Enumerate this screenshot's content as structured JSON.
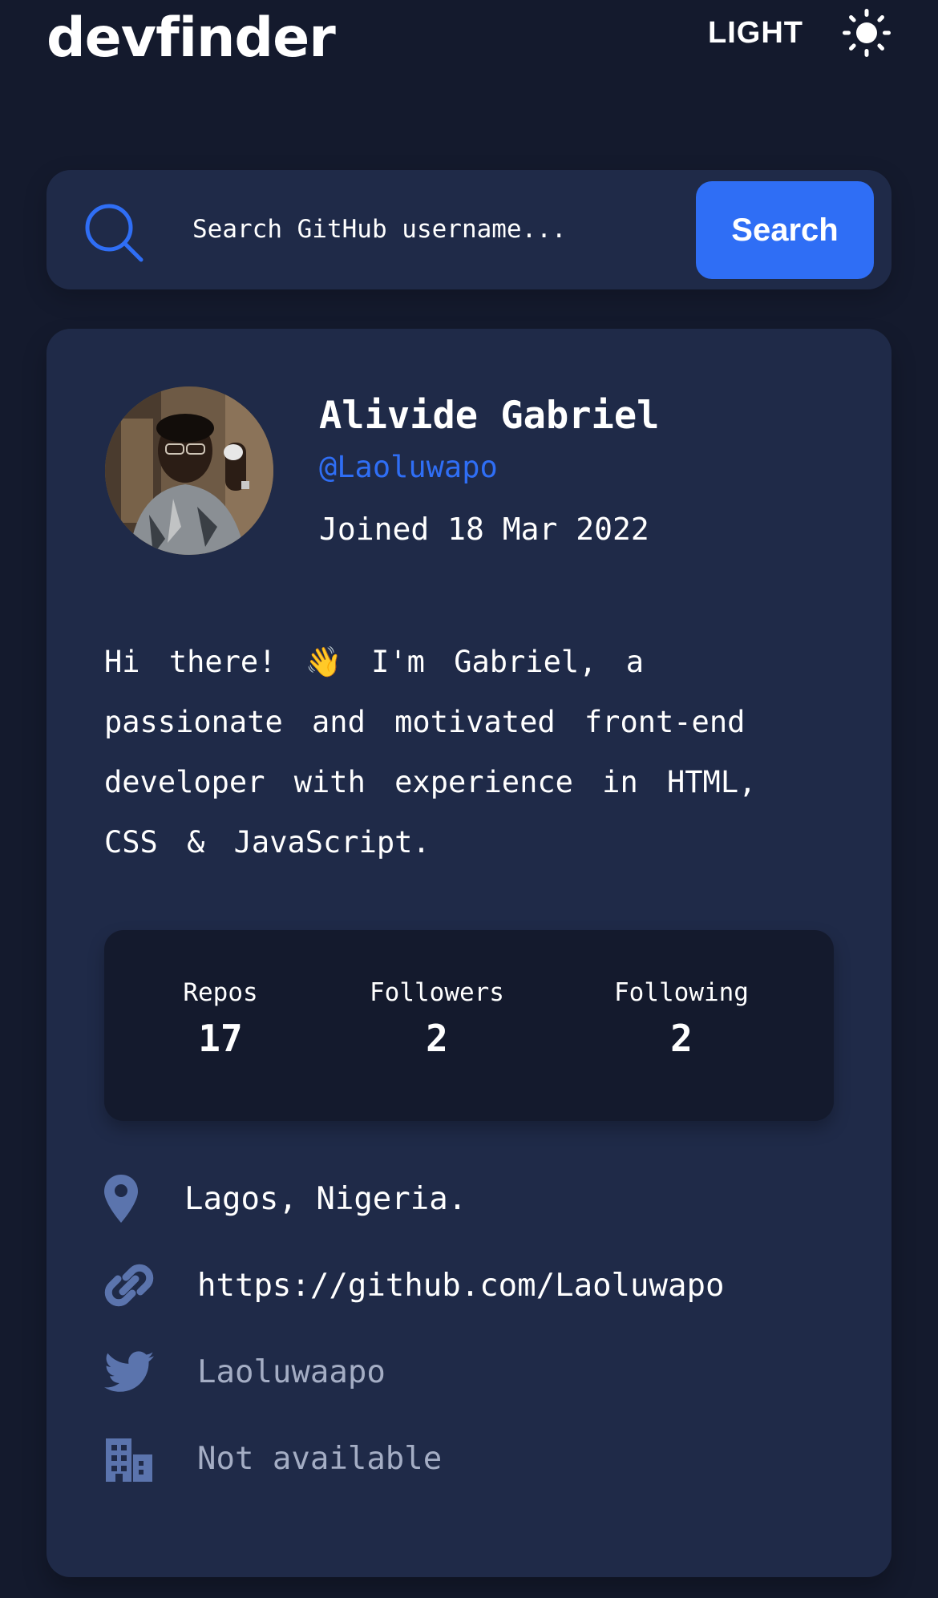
{
  "header": {
    "logo": "devfinder",
    "theme_label": "LIGHT",
    "theme_icon": "sun-icon"
  },
  "search": {
    "placeholder": "Search GitHub username...",
    "button_label": "Search",
    "icon": "search-icon"
  },
  "profile": {
    "name": "Alivide Gabriel",
    "handle": "@Laoluwapo",
    "joined": "Joined 18 Mar 2022",
    "bio": "Hi there! 👋 I'm Gabriel, a passionate and motivated front-end developer with experience in HTML, CSS & JavaScript.",
    "stats": [
      {
        "label": "Repos",
        "value": "17"
      },
      {
        "label": "Followers",
        "value": "2"
      },
      {
        "label": "Following",
        "value": "2"
      }
    ],
    "info": {
      "location": {
        "icon": "location-pin-icon",
        "text": "Lagos, Nigeria."
      },
      "blog": {
        "icon": "link-icon",
        "text": "https://github.com/Laoluwapo"
      },
      "twitter": {
        "icon": "twitter-icon",
        "text": "Laoluwaapo"
      },
      "company": {
        "icon": "company-building-icon",
        "text": "Not available"
      }
    }
  },
  "colors": {
    "background": "#141a2d",
    "card": "#1f2a48",
    "accent": "#2f6ef5",
    "icon_muted": "#5b74ad",
    "text_muted": "#a4adc4"
  }
}
